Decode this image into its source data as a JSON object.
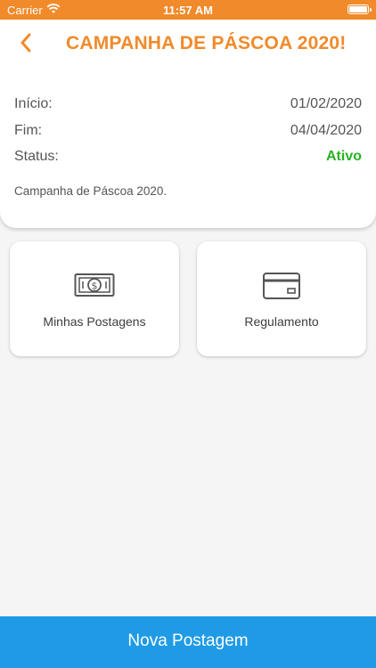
{
  "status_bar": {
    "carrier": "Carrier",
    "time": "11:57 AM"
  },
  "header": {
    "title": "CAMPANHA DE PÁSCOA 2020!",
    "back_icon": "chevron-left-icon"
  },
  "campaign": {
    "start_label": "Início:",
    "start_value": "01/02/2020",
    "end_label": "Fim:",
    "end_value": "04/04/2020",
    "status_label": "Status:",
    "status_value": "Ativo",
    "description": "Campanha de Páscoa 2020."
  },
  "tiles": [
    {
      "label": "Minhas Postagens",
      "icon": "money-bill-icon"
    },
    {
      "label": "Regulamento",
      "icon": "credit-card-icon"
    }
  ],
  "action": {
    "label": "Nova Postagem"
  },
  "colors": {
    "accent": "#f08a2a",
    "status_active": "#27b324",
    "primary_button": "#1f9be6"
  }
}
